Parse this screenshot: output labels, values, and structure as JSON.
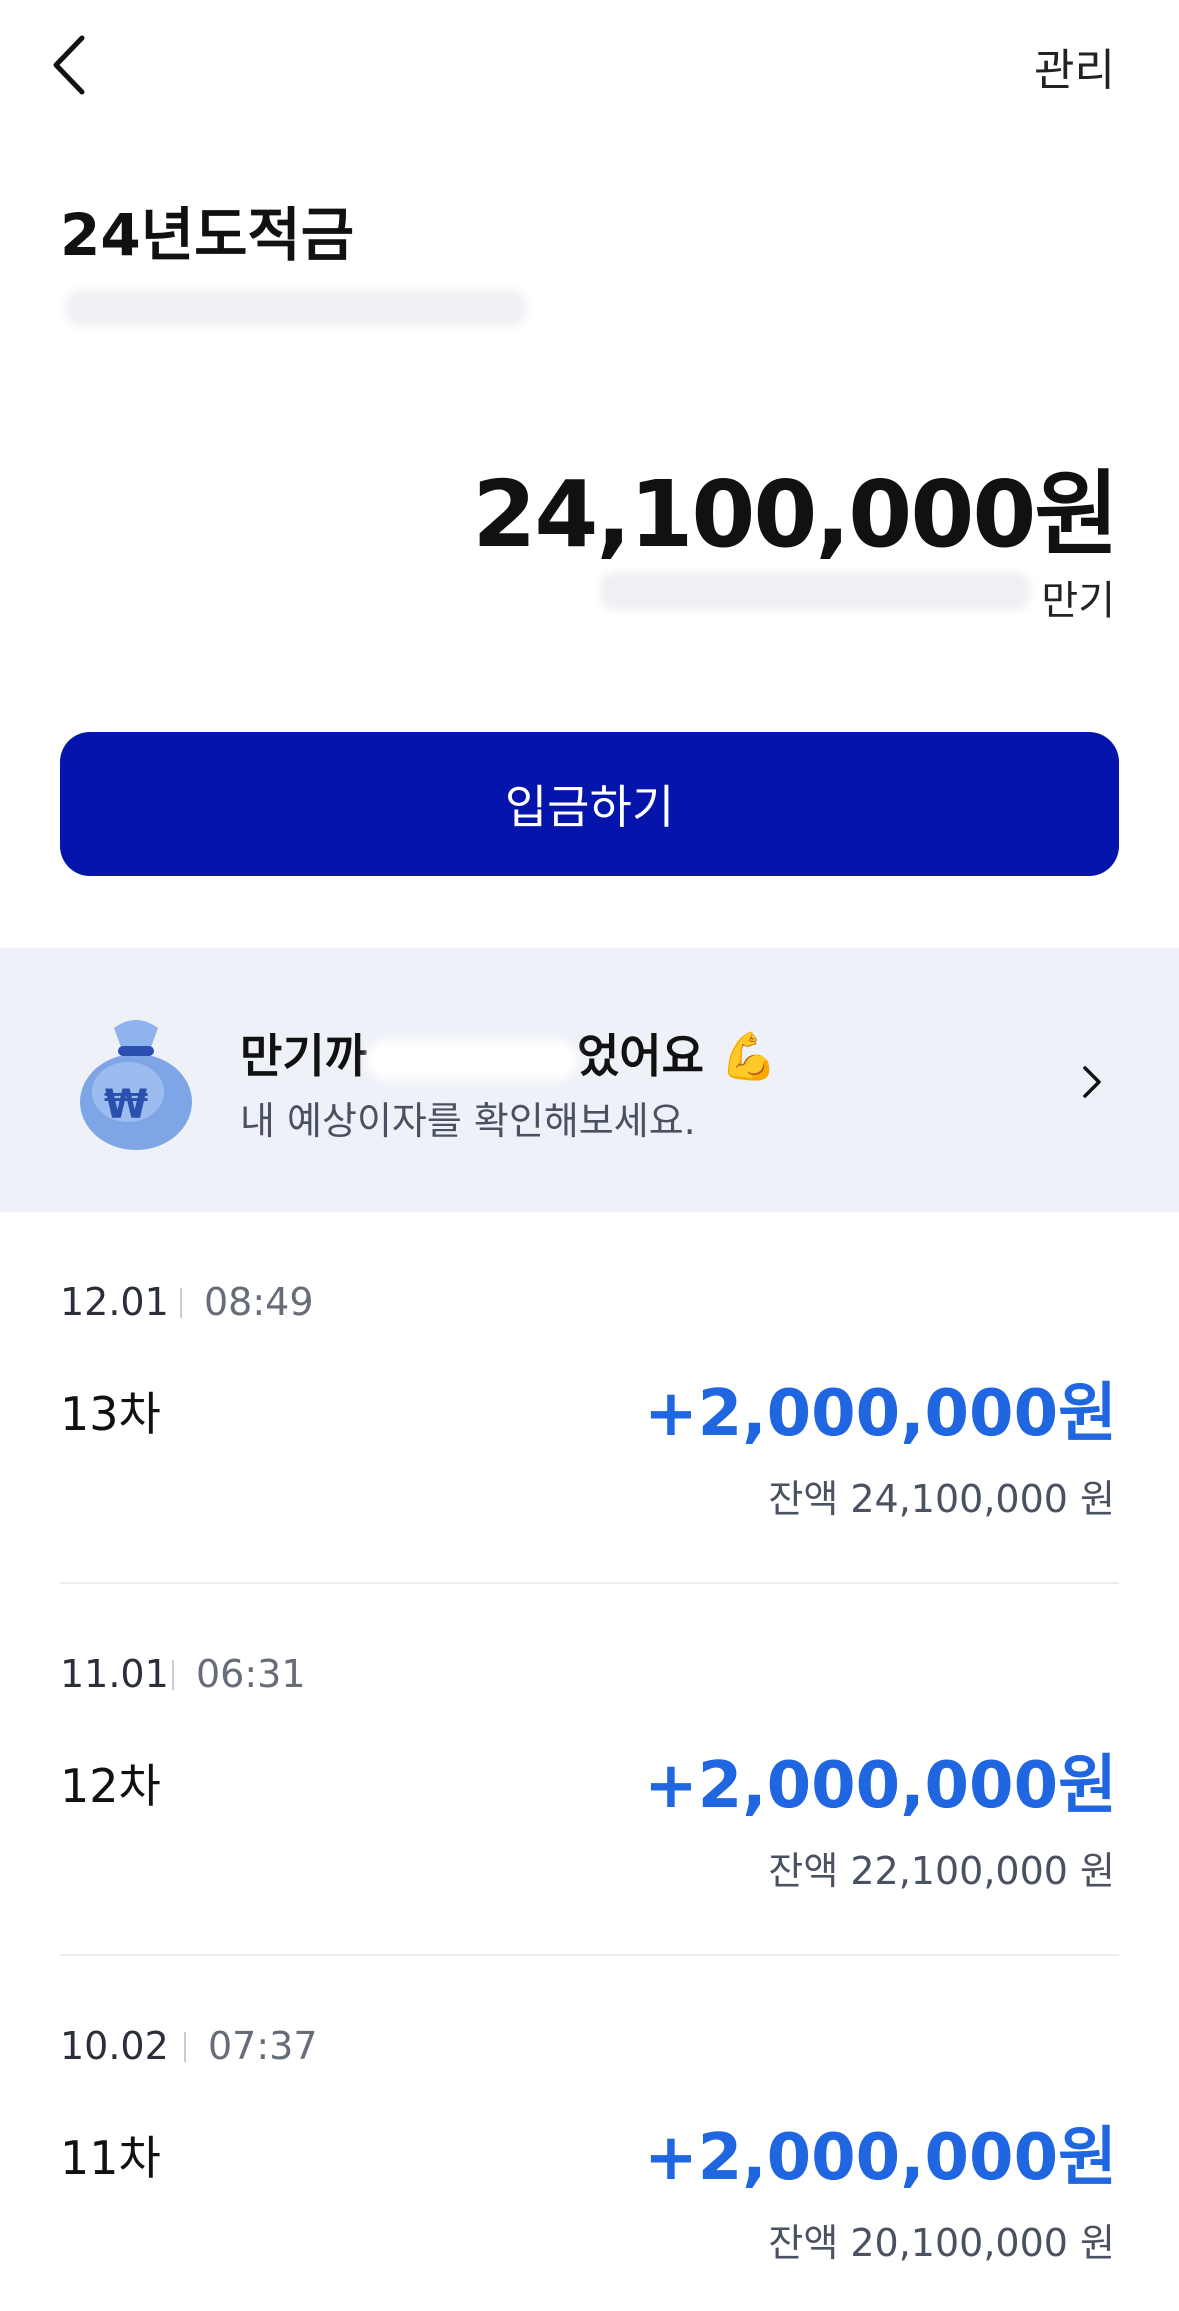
{
  "header": {
    "manage_label": "관리"
  },
  "account": {
    "title": "24년도적금",
    "balance": "24,100,000원",
    "maturity_suffix": "만기"
  },
  "deposit_button": {
    "label": "입금하기"
  },
  "banner": {
    "title_left": "만기까",
    "title_right": "었어요",
    "emoji": "💪",
    "subtitle": "내 예상이자를 확인해보세요."
  },
  "transactions": [
    {
      "date": "12.01",
      "time": "08:49",
      "label": "13차",
      "amount": "+2,000,000원",
      "balance": "잔액 24,100,000 원"
    },
    {
      "date": "11.01",
      "time": "06:31",
      "label": "12차",
      "amount": "+2,000,000원",
      "balance": "잔액 22,100,000 원"
    },
    {
      "date": "10.02",
      "time": "07:37",
      "label": "11차",
      "amount": "+2,000,000원",
      "balance": "잔액 20,100,000 원"
    }
  ],
  "colors": {
    "primary": "#0514ab",
    "amount": "#1f66e0",
    "banner_bg": "#eef1f8"
  }
}
